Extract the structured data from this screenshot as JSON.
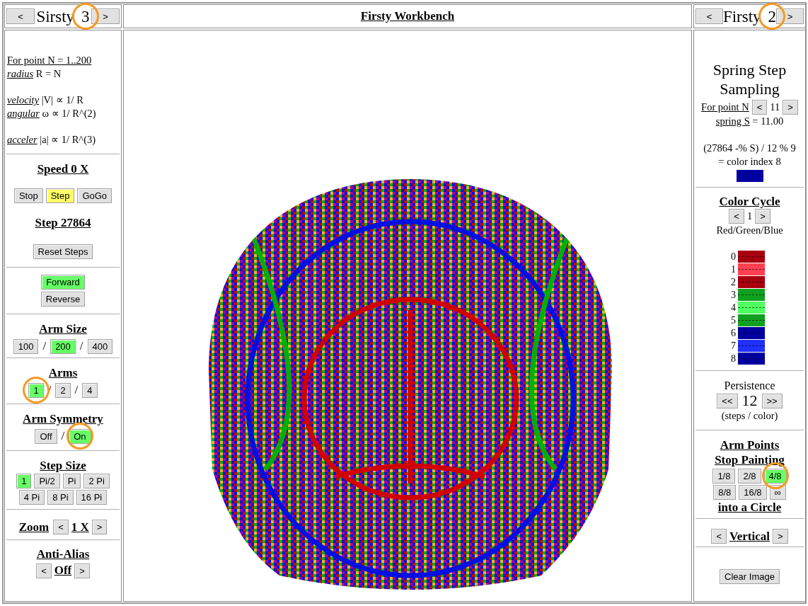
{
  "left_header": {
    "prev": "<",
    "title": "Sirsty",
    "number": "3",
    "next": ">",
    "circled": true
  },
  "center_header": {
    "title": "Firsty Workbench"
  },
  "right_header": {
    "prev": "<",
    "title": "Firsty",
    "number": "2",
    "next": ">",
    "circled": true
  },
  "left_sections": [
    {
      "kind": "formulas",
      "groups": [
        [
          {
            "italic": false,
            "term": "For point N = 1..200"
          },
          {
            "italic": true,
            "term": "radius",
            "rest": "R = N"
          }
        ],
        [
          {
            "italic": true,
            "term": "velocity",
            "rest": "|V| ∝ 1/ R"
          },
          {
            "italic": true,
            "term": "angular",
            "rest": "ω ∝ 1/ R^(2)"
          }
        ],
        [
          {
            "italic": true,
            "term": "acceler",
            "rest": "|a| ∝ 1/ R^(3)"
          }
        ]
      ]
    },
    {
      "kind": "speed",
      "title": "Speed 0 X",
      "buttons": [
        {
          "label": "Stop",
          "selected": false
        },
        {
          "label": "Step",
          "selected": true
        },
        {
          "label": "GoGo",
          "selected": false
        }
      ],
      "step_title": "Step 27864",
      "reset": "Reset Steps"
    },
    {
      "kind": "stack",
      "buttons": [
        {
          "label": "Forward",
          "selected": true
        },
        {
          "label": "Reverse",
          "selected": false
        }
      ]
    },
    {
      "kind": "options",
      "titles": [
        "Arm Size"
      ],
      "options": [
        {
          "label": "100",
          "selected": false,
          "circled": false
        },
        {
          "separator": "/",
          "label": "200",
          "selected": true,
          "circled": false
        },
        {
          "separator": "/",
          "label": "400",
          "selected": false,
          "circled": false
        }
      ]
    },
    {
      "kind": "options",
      "titles": [
        "Arms"
      ],
      "options": [
        {
          "label": "1",
          "selected": true,
          "circled": true
        },
        {
          "separator": "/",
          "label": "2",
          "selected": false,
          "circled": false
        },
        {
          "separator": "/",
          "label": "4",
          "selected": false,
          "circled": false
        }
      ]
    },
    {
      "kind": "options",
      "titles": [
        "Arm Symmetry"
      ],
      "options": [
        {
          "label": "Off",
          "selected": false,
          "circled": false
        },
        {
          "separator": "/",
          "label": "On",
          "selected": true,
          "circled": true
        }
      ]
    },
    {
      "kind": "options",
      "titles": [
        "Step Size"
      ],
      "options": [
        {
          "label": "1",
          "selected": true,
          "circled": false
        },
        {
          "label": "Pi/2",
          "selected": false,
          "circled": false
        },
        {
          "label": "Pi",
          "selected": false,
          "circled": false
        },
        {
          "label": "2 Pi",
          "selected": false,
          "circled": false
        },
        {
          "label": "4 Pi",
          "selected": false,
          "circled": false
        },
        {
          "label": "8 Pi",
          "selected": false,
          "circled": false
        },
        {
          "label": "16 Pi",
          "selected": false,
          "circled": false
        }
      ]
    },
    {
      "kind": "inline_stepper",
      "title": "Zoom",
      "prev": "<",
      "value": "1 X",
      "next": ">"
    },
    {
      "kind": "stepper",
      "title": "Anti-Alias",
      "prev": "<",
      "value": "Off",
      "next": ">"
    }
  ],
  "right_sections": [
    {
      "kind": "spring",
      "title": "Spring Step Sampling",
      "point_label": "For point N",
      "prev": "<",
      "value": "11",
      "next": ">",
      "spring_term": "spring S",
      "spring_rest": "= 11.00",
      "formula": "(27864 -% S) / 12 % 9",
      "result": "= color index 8",
      "swatch": {
        "color": "#0000a0"
      }
    },
    {
      "kind": "palette",
      "title": "Color Cycle",
      "prev": "<",
      "value": "1",
      "next": ">",
      "caption": "Red/Green/Blue",
      "colors": [
        {
          "index": "0",
          "color": "#a8000f"
        },
        {
          "index": "1",
          "color": "#ff4050"
        },
        {
          "index": "2",
          "color": "#a8000f"
        },
        {
          "index": "3",
          "color": "#10a020"
        },
        {
          "index": "4",
          "color": "#50ff60"
        },
        {
          "index": "5",
          "color": "#10a020"
        },
        {
          "index": "6",
          "color": "#0000a0"
        },
        {
          "index": "7",
          "color": "#2030ff"
        },
        {
          "index": "8",
          "color": "#0000a0"
        }
      ]
    },
    {
      "kind": "persistence",
      "title": "Persistence",
      "prev": "<<",
      "value": "12",
      "next": ">>",
      "caption": "(steps / color)"
    },
    {
      "kind": "options",
      "titles": [
        "Arm Points",
        "Stop Painting"
      ],
      "options": [
        {
          "label": "1/8",
          "selected": false,
          "circled": false
        },
        {
          "label": "2/8",
          "selected": false,
          "circled": false
        },
        {
          "label": "4/8",
          "selected": true,
          "circled": true
        },
        {
          "label": "8/8",
          "selected": false,
          "circled": false
        },
        {
          "label": "16/8",
          "selected": false,
          "circled": false
        },
        {
          "label": "∞",
          "selected": false,
          "circled": false
        }
      ],
      "footer": "into a Circle"
    },
    {
      "kind": "inline_stepper",
      "prev": "<",
      "value": "Vertical",
      "next": ">"
    },
    {
      "kind": "button",
      "label": "Clear Image"
    }
  ]
}
